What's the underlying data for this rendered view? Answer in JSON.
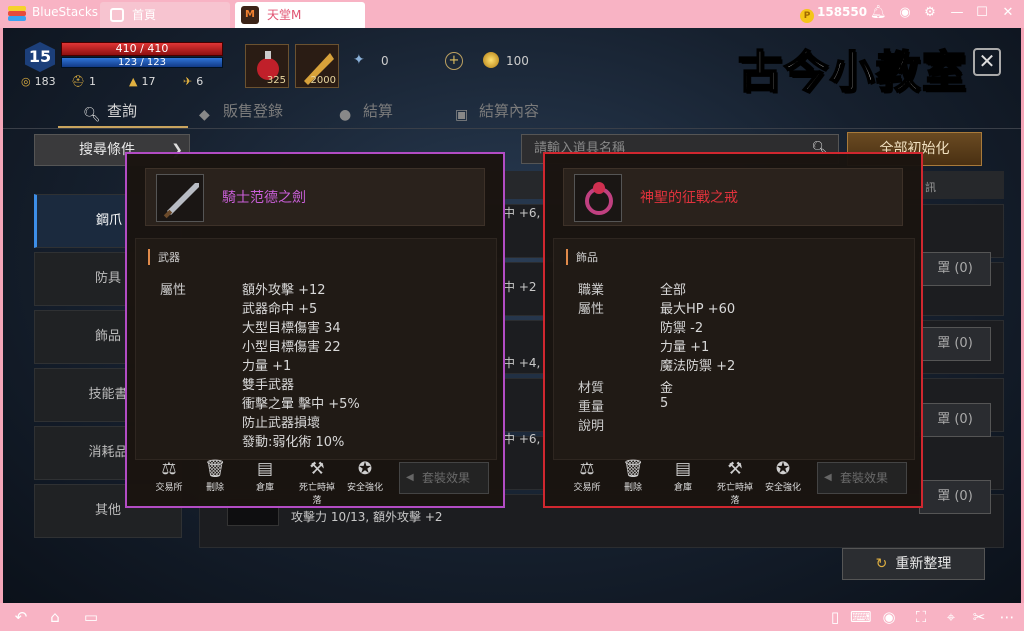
{
  "window": {
    "brand": "BlueStacks",
    "tabs": [
      {
        "label": "首頁"
      },
      {
        "label": "天堂M",
        "icon_text": "M"
      }
    ],
    "coins": "158550"
  },
  "hud": {
    "level": "15",
    "hp": "410 / 410",
    "mp": "123 / 123",
    "stats": [
      {
        "icon": "ring-icon",
        "value": "183"
      },
      {
        "icon": "helmet-icon",
        "value": "1"
      },
      {
        "icon": "boot-icon",
        "value": "17"
      },
      {
        "icon": "wing-icon",
        "value": "6"
      }
    ],
    "potion_qty": "325",
    "scroll_qty": "2000",
    "gems": "0",
    "gold": "100"
  },
  "watermark": "古今小教室",
  "nav": {
    "tabs": [
      {
        "label": "查詢",
        "active": true
      },
      {
        "label": "販售登錄"
      },
      {
        "label": "結算"
      },
      {
        "label": "結算內容"
      }
    ]
  },
  "filter": {
    "search_condition": "搜尋條件",
    "search_placeholder": "請輸入道具名稱",
    "reset_all": "全部初始化"
  },
  "categories": [
    "鋼爪",
    "防具",
    "飾品",
    "技能書",
    "消耗品",
    "其他"
  ],
  "list": {
    "column_head": "訊",
    "rows": [
      {
        "text": "中 +6,",
        "button": ""
      },
      {
        "text": "中 +2",
        "button": "罩 (0)"
      },
      {
        "text": "中 +4,",
        "button": "罩 (0)"
      },
      {
        "text": "中 +6,",
        "button": "罩 (0)"
      },
      {
        "text": "",
        "button": "罩 (0)"
      },
      {
        "text": "攻擊力 10/13, 額外攻擊 +2",
        "button": ""
      }
    ],
    "reorganize": "重新整理"
  },
  "popup_weapon": {
    "name": "騎士范德之劍",
    "type": "武器",
    "attr_label": "屬性",
    "attrs": [
      "額外攻擊 +12",
      "武器命中 +5",
      "大型目標傷害 34",
      "小型目標傷害 22",
      "力量 +1",
      "雙手武器",
      "衝擊之暈 擊中 +5%",
      "防止武器損壞",
      "發動:弱化術 10%"
    ],
    "name_color": "#c95fd8"
  },
  "popup_ring": {
    "name": "神聖的征戰之戒",
    "type": "飾品",
    "rows": [
      {
        "label": "職業",
        "value": "全部"
      },
      {
        "label": "屬性",
        "value": "最大HP +60"
      },
      {
        "label": "",
        "value": "防禦 -2"
      },
      {
        "label": "",
        "value": "力量 +1"
      },
      {
        "label": "",
        "value": "魔法防禦 +2"
      },
      {
        "label": "材質",
        "value": "金"
      },
      {
        "label": "重量",
        "value": "5"
      },
      {
        "label": "說明",
        "value": ""
      }
    ],
    "name_color": "#e0323c"
  },
  "popup_footer": {
    "trade": "交易所",
    "delete": "刪除",
    "warehouse": "倉庫",
    "death_drop": "死亡時掉落",
    "safe_enhance": "安全強化",
    "set_effect": "套裝效果"
  }
}
